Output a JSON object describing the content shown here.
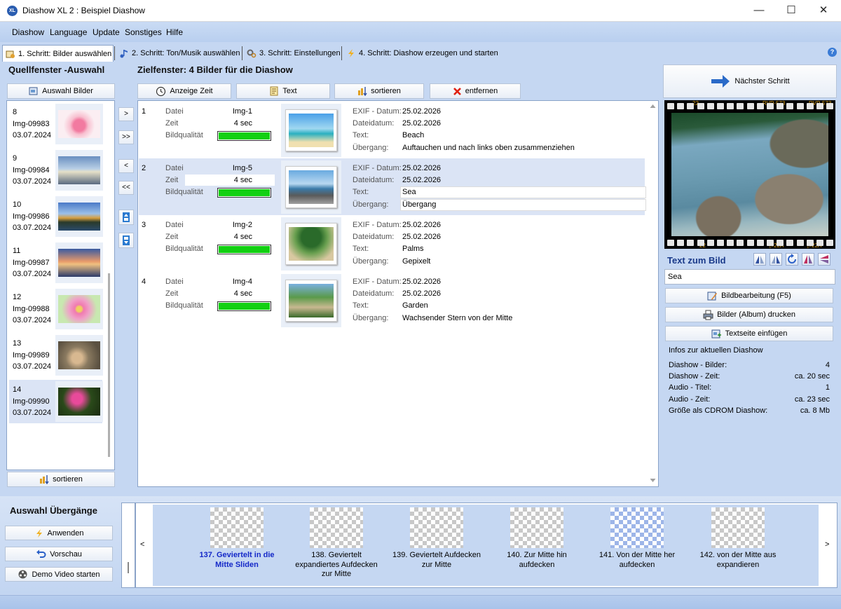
{
  "window": {
    "title": "Diashow XL 2 : Beispiel Diashow",
    "app_icon": "XL",
    "min": "—",
    "max": "☐",
    "close": "✕"
  },
  "menu": [
    "Diashow",
    "Language",
    "Update",
    "Sonstiges",
    "Hilfe"
  ],
  "tabs": [
    {
      "label": "1. Schritt: Bilder auswählen",
      "icon": "images-icon"
    },
    {
      "label": "2. Schritt: Ton/Musik auswählen",
      "icon": "music-icon"
    },
    {
      "label": "3. Schritt: Einstellungen",
      "icon": "gears-icon"
    },
    {
      "label": "4. Schritt: Diashow erzeugen und starten",
      "icon": "lightning-icon"
    }
  ],
  "help": "?",
  "source": {
    "title": "Quellfenster -Auswahl",
    "select_button": "Auswahl Bilder",
    "sort_button": "sortieren",
    "items": [
      {
        "num": "8",
        "name": "Img-09983",
        "date": "03.07.2024"
      },
      {
        "num": "9",
        "name": "Img-09984",
        "date": "03.07.2024"
      },
      {
        "num": "10",
        "name": "Img-09986",
        "date": "03.07.2024"
      },
      {
        "num": "11",
        "name": "Img-09987",
        "date": "03.07.2024"
      },
      {
        "num": "12",
        "name": "Img-09988",
        "date": "03.07.2024"
      },
      {
        "num": "13",
        "name": "Img-09989",
        "date": "03.07.2024"
      },
      {
        "num": "14",
        "name": "Img-09990",
        "date": "03.07.2024"
      }
    ]
  },
  "mid_buttons": [
    ">",
    ">>",
    "<",
    "<<"
  ],
  "target": {
    "title": "Zielfenster: 4 Bilder für die Diashow",
    "toolbar": {
      "time": "Anzeige Zeit",
      "text": "Text",
      "sort": "sortieren",
      "remove": "entfernen"
    },
    "labels": {
      "file": "Datei",
      "time": "Zeit",
      "quality": "Bildqualität",
      "exif": "EXIF - Datum:",
      "filedate": "Dateidatum:",
      "text": "Text:",
      "transition": "Übergang:"
    },
    "rows": [
      {
        "num": "1",
        "file": "Img-1",
        "time": "4 sec",
        "quality": 1.0,
        "exif": "25.02.2026",
        "filedate": "25.02.2026",
        "text": "Beach",
        "transition": "Auftauchen und nach links oben zusammenziehen"
      },
      {
        "num": "2",
        "file": "Img-5",
        "time": "4 sec",
        "quality": 1.0,
        "exif": "25.02.2026",
        "filedate": "25.02.2026",
        "text": "Sea",
        "transition": "Übergang"
      },
      {
        "num": "3",
        "file": "Img-2",
        "time": "4 sec",
        "quality": 1.0,
        "exif": "25.02.2026",
        "filedate": "25.02.2026",
        "text": "Palms",
        "transition": "Gepixelt"
      },
      {
        "num": "4",
        "file": "Img-4",
        "time": "4 sec",
        "quality": 1.0,
        "exif": "25.02.2026",
        "filedate": "25.02.2026",
        "text": "Garden",
        "transition": "Wachsender Stern von der Mitte"
      }
    ]
  },
  "right": {
    "next_step": "Nächster Schritt",
    "film_numbers": [
      "22",
      "RVP-573",
      "RVP-573",
      "22",
      "▷22A",
      "▷22A"
    ],
    "text_heading": "Text zum Bild",
    "text_value": "Sea",
    "edit_button": "Bildbearbeitung (F5)",
    "print_button": "Bilder (Album) drucken",
    "textpage_button": "Textseite einfügen",
    "info_title": "Infos zur aktuellen Diashow",
    "info": [
      {
        "label": "Diashow - Bilder:",
        "value": "4"
      },
      {
        "label": "Diashow - Zeit:",
        "value": "ca. 20 sec"
      },
      {
        "label": "Audio - Titel:",
        "value": "1"
      },
      {
        "label": "Audio - Zeit:",
        "value": "ca. 23 sec"
      },
      {
        "label": "Größe als CDROM Diashow:",
        "value": "ca. 8 Mb"
      }
    ]
  },
  "transitions": {
    "title": "Auswahl Übergänge",
    "apply": "Anwenden",
    "preview": "Vorschau",
    "demo": "Demo Video starten",
    "prev": "<",
    "next": ">",
    "items": [
      {
        "label": "137. Geviertelt in die Mitte Sliden",
        "selected": true
      },
      {
        "label": "138. Geviertelt expandiertes Aufdecken zur Mitte",
        "selected": false
      },
      {
        "label": "139. Geviertelt Aufdecken zur Mitte",
        "selected": false
      },
      {
        "label": "140. Zur Mitte hin aufdecken",
        "selected": false
      },
      {
        "label": "141. Von der Mitte her aufdecken",
        "selected": false
      },
      {
        "label": "142. von der Mitte aus expandieren",
        "selected": false
      }
    ]
  },
  "colors": {
    "accent": "#1428c8",
    "quality_bar": "#12d012",
    "background": "#c5d7f2"
  }
}
